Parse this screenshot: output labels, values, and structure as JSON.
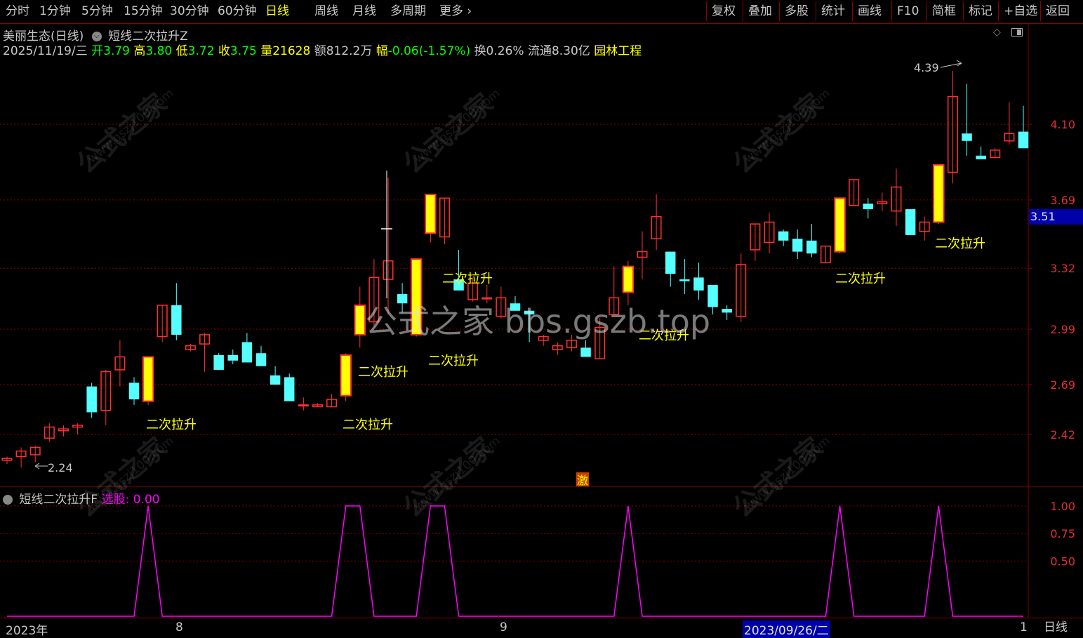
{
  "toolbar": {
    "left": [
      "分时",
      "1分钟",
      "5分钟",
      "15分钟",
      "30分钟",
      "60分钟",
      "日线",
      "周线",
      "月线",
      "多周期",
      "更多"
    ],
    "active": "日线",
    "right": [
      "复权",
      "叠加",
      "多股",
      "统计",
      "画线",
      "F10",
      "简框",
      "标记",
      "+自选",
      "返回"
    ]
  },
  "stock": {
    "name": "美丽生态(日线)",
    "indicator": "短线二次拉升Z"
  },
  "quote": {
    "date": "2025/11/19/三",
    "open_label": "开",
    "open": "3.79",
    "high_label": "高",
    "high": "3.80",
    "low_label": "低",
    "low": "3.72",
    "close_label": "收",
    "close": "3.75",
    "vol_label": "量",
    "vol": "21628",
    "amt_label": "额",
    "amt": "812.2万",
    "chg_label": "幅",
    "chg": "-0.06(-1.57%)",
    "turnover": "换0.26%",
    "float": "流通8.30亿",
    "sector": "园林工程"
  },
  "price_axis": [
    "4.10",
    "3.69",
    "3.32",
    "2.99",
    "2.69",
    "2.42"
  ],
  "current_price": "3.51",
  "max_label": "4.39",
  "min_label": "2.24",
  "signal_label": "二次拉升",
  "marker_char": "激",
  "watermark_center": "公式之家 bbs.gszb.top",
  "watermark_cn": "公式之家",
  "watermark_url": "www.gszj100.com",
  "indicator_panel": {
    "name": "短线二次拉升F",
    "series_label": "选股:",
    "series_value": "0.00",
    "axis": [
      "1.00",
      "0.75",
      "0.50"
    ]
  },
  "time_axis": {
    "labels": [
      "2023年",
      "8",
      "9",
      "2023/09/26/二",
      "1"
    ],
    "period": "日线"
  },
  "colors": {
    "up": "#ff3030",
    "down": "#54ffff",
    "signal": "#ffff00",
    "grid": "#8b0000",
    "indicator": "#ff00ff"
  },
  "chart_data": {
    "type": "candlestick",
    "ylim": [
      2.15,
      4.45
    ],
    "candles": [
      [
        2.28,
        2.3,
        2.26,
        2.29,
        false
      ],
      [
        2.3,
        2.35,
        2.24,
        2.33,
        false
      ],
      [
        2.31,
        2.36,
        2.27,
        2.35,
        false
      ],
      [
        2.4,
        2.48,
        2.38,
        2.46,
        false
      ],
      [
        2.44,
        2.47,
        2.41,
        2.45,
        false
      ],
      [
        2.46,
        2.48,
        2.42,
        2.47,
        false
      ],
      [
        2.68,
        2.7,
        2.51,
        2.54,
        false
      ],
      [
        2.55,
        2.77,
        2.47,
        2.76,
        false
      ],
      [
        2.77,
        2.93,
        2.68,
        2.84,
        false
      ],
      [
        2.7,
        2.73,
        2.58,
        2.61,
        false
      ],
      [
        2.6,
        2.84,
        2.58,
        2.84,
        true
      ],
      [
        2.95,
        3.03,
        2.92,
        3.12,
        false
      ],
      [
        3.12,
        3.24,
        2.93,
        2.96,
        false
      ],
      [
        2.88,
        2.91,
        2.87,
        2.9,
        false
      ],
      [
        2.91,
        2.97,
        2.76,
        2.96,
        false
      ],
      [
        2.85,
        2.86,
        2.8,
        2.77,
        false
      ],
      [
        2.85,
        2.88,
        2.8,
        2.82,
        false
      ],
      [
        2.92,
        2.97,
        2.84,
        2.81,
        false
      ],
      [
        2.86,
        2.9,
        2.81,
        2.79,
        false
      ],
      [
        2.74,
        2.79,
        2.72,
        2.69,
        false
      ],
      [
        2.73,
        2.75,
        2.66,
        2.6,
        false
      ],
      [
        2.58,
        2.62,
        2.55,
        2.58,
        false
      ],
      [
        2.57,
        2.59,
        2.59,
        2.58,
        false
      ],
      [
        2.57,
        2.64,
        2.57,
        2.61,
        false
      ],
      [
        2.63,
        2.86,
        2.6,
        2.85,
        true
      ],
      [
        2.96,
        3.22,
        2.89,
        3.12,
        true
      ],
      [
        3.03,
        3.37,
        3.01,
        3.27,
        false
      ],
      [
        3.26,
        3.81,
        3.07,
        3.36,
        false
      ],
      [
        3.18,
        3.24,
        3.08,
        3.13,
        false
      ],
      [
        2.96,
        3.37,
        2.95,
        3.37,
        true
      ],
      [
        3.51,
        3.61,
        3.46,
        3.72,
        true
      ],
      [
        3.49,
        3.67,
        3.45,
        3.7,
        false
      ],
      [
        3.26,
        3.42,
        3.22,
        3.2,
        false
      ],
      [
        3.15,
        3.27,
        3.14,
        3.24,
        false
      ],
      [
        3.16,
        3.23,
        3.13,
        3.16,
        false
      ],
      [
        3.06,
        3.22,
        3.05,
        3.16,
        false
      ],
      [
        3.13,
        3.17,
        3.09,
        3.09,
        false
      ],
      [
        3.09,
        3.02,
        2.92,
        3.07,
        false
      ],
      [
        2.93,
        2.96,
        2.9,
        2.95,
        false
      ],
      [
        2.88,
        2.92,
        2.85,
        2.9,
        false
      ],
      [
        2.89,
        2.96,
        2.87,
        2.93,
        false
      ],
      [
        2.89,
        2.93,
        2.86,
        2.84,
        false
      ],
      [
        2.83,
        3.05,
        2.84,
        3.0,
        false
      ],
      [
        3.07,
        3.33,
        3.08,
        3.16,
        false
      ],
      [
        3.19,
        3.36,
        3.12,
        3.33,
        true
      ],
      [
        3.38,
        3.52,
        3.26,
        3.41,
        false
      ],
      [
        3.48,
        3.72,
        3.42,
        3.6,
        false
      ],
      [
        3.41,
        3.34,
        3.22,
        3.29,
        false
      ],
      [
        3.26,
        3.37,
        3.18,
        3.25,
        false
      ],
      [
        3.27,
        3.35,
        3.15,
        3.2,
        false
      ],
      [
        3.23,
        3.13,
        3.07,
        3.11,
        false
      ],
      [
        3.1,
        3.12,
        3.04,
        3.08,
        false
      ],
      [
        3.06,
        3.4,
        3.03,
        3.34,
        false
      ],
      [
        3.42,
        3.52,
        3.36,
        3.56,
        false
      ],
      [
        3.46,
        3.62,
        3.4,
        3.57,
        false
      ],
      [
        3.52,
        3.53,
        3.44,
        3.47,
        false
      ],
      [
        3.48,
        3.53,
        3.37,
        3.41,
        false
      ],
      [
        3.47,
        3.56,
        3.38,
        3.4,
        false
      ],
      [
        3.35,
        3.4,
        3.35,
        3.44,
        false
      ],
      [
        3.41,
        3.62,
        3.4,
        3.7,
        true
      ],
      [
        3.66,
        3.75,
        3.66,
        3.8,
        false
      ],
      [
        3.67,
        3.7,
        3.59,
        3.64,
        false
      ],
      [
        3.67,
        3.73,
        3.63,
        3.68,
        false
      ],
      [
        3.63,
        3.86,
        3.55,
        3.76,
        false
      ],
      [
        3.64,
        3.61,
        3.52,
        3.5,
        false
      ],
      [
        3.52,
        3.6,
        3.47,
        3.57,
        false
      ],
      [
        3.57,
        3.82,
        3.56,
        3.88,
        true
      ],
      [
        3.84,
        4.39,
        3.78,
        4.25,
        false
      ],
      [
        4.05,
        4.32,
        3.93,
        4.01,
        false
      ],
      [
        3.93,
        3.98,
        3.92,
        3.91,
        false
      ],
      [
        3.92,
        3.97,
        3.98,
        3.96,
        false
      ],
      [
        4.01,
        4.22,
        3.99,
        4.05,
        false
      ],
      [
        4.06,
        4.2,
        3.99,
        3.97,
        false
      ]
    ],
    "signals": [
      {
        "index": 10,
        "label_pos": "below"
      },
      {
        "index": 24,
        "label_pos": "below"
      },
      {
        "index": 29,
        "label_pos": "below"
      },
      {
        "index": 44,
        "label_pos": "below"
      },
      {
        "index": 59,
        "label_pos": "below"
      },
      {
        "index": 66,
        "label_pos": "below"
      }
    ],
    "indicator_series": {
      "name": "选股",
      "ylim": [
        0,
        1.05
      ],
      "peaks": [
        10,
        [
          24,
          25
        ],
        [
          30,
          31
        ],
        44,
        59,
        66
      ]
    }
  }
}
